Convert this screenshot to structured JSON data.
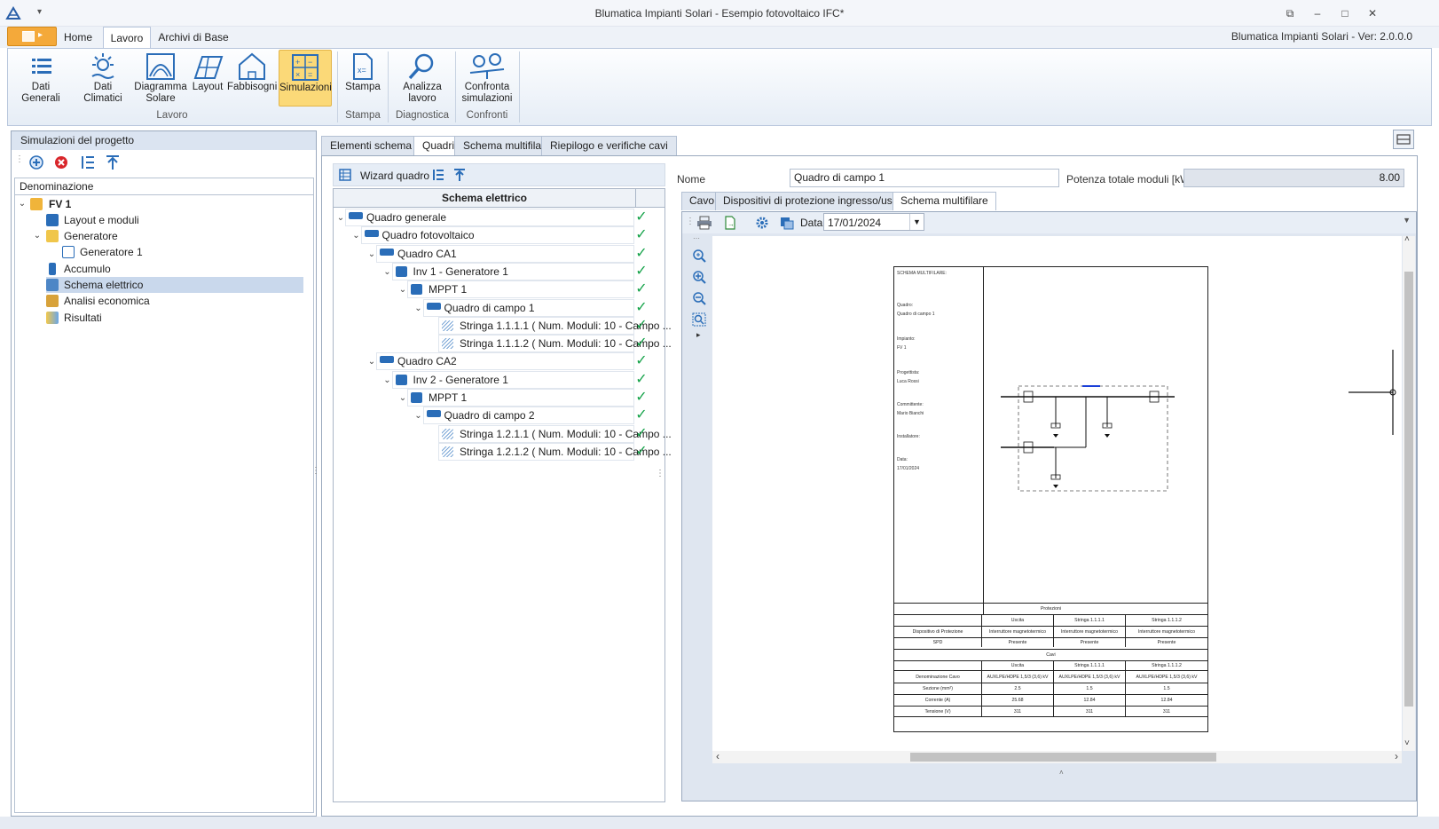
{
  "window": {
    "title": "Blumatica Impianti Solari - Esempio fotovoltaico IFC*",
    "version": "Blumatica Impianti Solari - Ver: 2.0.0.0"
  },
  "ribbon_tabs": [
    "Home",
    "Lavoro",
    "Archivi di Base"
  ],
  "ribbon": {
    "buttons": [
      {
        "label1": "Dati Generali",
        "label2": "",
        "icon": "list-icon"
      },
      {
        "label1": "Dati Climatici",
        "label2": "",
        "icon": "sun-icon"
      },
      {
        "label1": "Diagramma",
        "label2": "Solare",
        "icon": "solar-diagram-icon"
      },
      {
        "label1": "Layout",
        "label2": "",
        "icon": "layout-icon"
      },
      {
        "label1": "Fabbisogni",
        "label2": "",
        "icon": "house-icon"
      },
      {
        "label1": "Simulazioni",
        "label2": "",
        "icon": "calculator-icon"
      },
      {
        "label1": "Stampa",
        "label2": "",
        "icon": "document-icon"
      },
      {
        "label1": "Analizza",
        "label2": "lavoro",
        "icon": "magnifier-icon"
      },
      {
        "label1": "Confronta",
        "label2": "simulazioni",
        "icon": "compare-icon"
      }
    ],
    "groups": [
      "Lavoro",
      "Stampa",
      "Diagnostica",
      "Confronti"
    ]
  },
  "left_panel": {
    "title": "Simulazioni del progetto",
    "column": "Denominazione",
    "tree": [
      "FV 1",
      "Layout e moduli",
      "Generatore",
      "Generatore 1",
      "Accumulo",
      "Schema elettrico",
      "Analisi economica",
      "Risultati"
    ]
  },
  "main_tabs": [
    "Elementi schema",
    "Quadri",
    "Schema multifilare",
    "Riepilogo e verifiche cavi"
  ],
  "mid_panel": {
    "wizard_label": "Wizard quadro",
    "grid_header": "Schema elettrico",
    "rows": [
      "Quadro generale",
      "Quadro fotovoltaico",
      "Quadro CA1",
      "Inv 1 - Generatore 1",
      "MPPT 1",
      "Quadro di campo 1",
      "Stringa 1.1.1.1 ( Num. Moduli: 10 - Campo ...",
      "Stringa 1.1.1.2 ( Num. Moduli: 10 - Campo ...",
      "Quadro CA2",
      "Inv 2 - Generatore 1",
      "MPPT 1",
      "Quadro di campo 2",
      "Stringa 1.2.1.1 ( Num. Moduli: 10 - Campo ...",
      "Stringa 1.2.1.2 ( Num. Moduli: 10 - Campo ..."
    ]
  },
  "right_panel": {
    "name_label": "Nome",
    "name_value": "Quadro di campo 1",
    "power_label": "Potenza totale moduli [kW]",
    "power_value": "8.00",
    "subtabs": [
      "Cavo",
      "Dispositivi di protezione ingresso/uscita",
      "Schema multifilare"
    ],
    "date_label": "Data",
    "date_value": "17/01/2024"
  },
  "sheet": {
    "title": "SCHEMA MULTIFILARE:",
    "quadro_label": "Quadro:",
    "quadro_value": "Quadro di campo 1",
    "impianto_label": "Impianto:",
    "impianto_value": "FV 1",
    "progettista_label": "Progettista:",
    "progettista_value": "Luca Rossi",
    "committente_label": "Committente:",
    "committente_value": "Mario Bianchi",
    "installatore_label": "Installatore:",
    "data_label": "Data:",
    "data_value": "17/01/2024",
    "protezioni": "Protezioni",
    "col_uscita": "Uscita",
    "col_s1": "Stringa 1.1.1.1",
    "col_s2": "Stringa 1.1.1.2",
    "dispositivo_label": "Dispositivo di Protezione",
    "dispositivo_value": "Interruttore magnetotermico",
    "spd_label": "SPD",
    "spd_value": "Presente",
    "cavi": "Cavi",
    "den_cavo_label": "Denominazione Cavo",
    "den_cavo_value": "AUXLPE/HDPE 1,5/3 (3,6) kV",
    "sezione_label": "Sezione (mm²)",
    "sezione_uscita": "2.5",
    "sezione_s1": "1.5",
    "sezione_s2": "1.5",
    "corrente_label": "Corrente (A)",
    "corrente_uscita": "25.68",
    "corrente_s1": "12.84",
    "corrente_s2": "12.84",
    "tensione_label": "Tensione (V)",
    "tensione_value": "311"
  }
}
